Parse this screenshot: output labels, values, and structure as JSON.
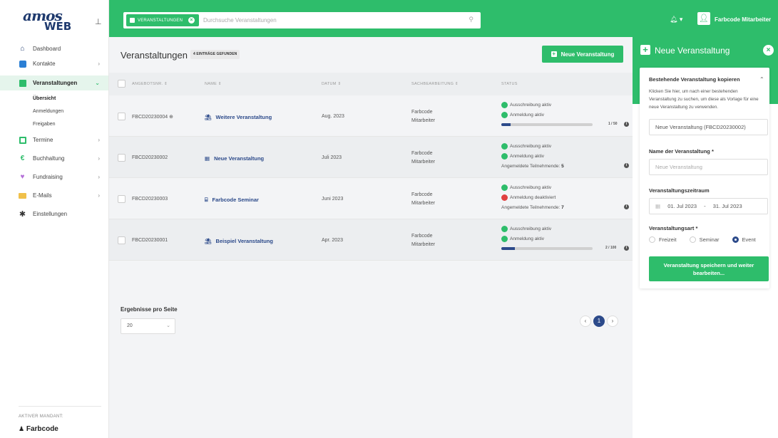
{
  "sidebar": {
    "logo_top": "amos",
    "logo_bottom": "WEB",
    "items": [
      {
        "label": "Dashboard"
      },
      {
        "label": "Kontakte"
      },
      {
        "label": "Veranstaltungen"
      },
      {
        "label": "Termine"
      },
      {
        "label": "Buchhaltung"
      },
      {
        "label": "Fundraising"
      },
      {
        "label": "E-Mails"
      },
      {
        "label": "Einstellungen"
      }
    ],
    "subitems": [
      {
        "label": "Übersicht"
      },
      {
        "label": "Anmeldungen"
      },
      {
        "label": "Freigaben"
      }
    ],
    "mandant_label": "AKTIVER MANDANT:",
    "mandant_name": "Farbcode"
  },
  "topbar": {
    "chip_label": "VERANSTALTUNGEN",
    "search_placeholder": "Durchsuche Veranstaltungen",
    "user_name": "Farbcode Mitarbeiter"
  },
  "main": {
    "title": "Veranstaltungen",
    "count_badge": "4 EINTRÄGE GEFUNDEN",
    "new_button": "Neue Veranstaltung",
    "columns": {
      "number": "ANGEBOTSNR. ⇕",
      "name": "NAME ⇕",
      "date": "DATUM ⇕",
      "staff": "SACHBEARBEITUNG ⇕",
      "status": "STATUS"
    },
    "rows": [
      {
        "number": "FBCD20230004",
        "name": "Weitere Veranstaltung",
        "date": "Aug. 2023",
        "staff_line1": "Farbcode",
        "staff_line2": "Mitarbeiter",
        "status1": "Ausschreibung aktiv",
        "status2": "Anmeldung aktiv",
        "progress_label": "1 / 50",
        "progress_fraction": 0.02
      },
      {
        "number": "FBCD20230002",
        "name": "Neue Veranstaltung",
        "date": "Juli 2023",
        "staff_line1": "Farbcode",
        "staff_line2": "Mitarbeiter",
        "status1": "Ausschreibung aktiv",
        "status2": "Anmeldung aktiv",
        "participants_label": "Angemeldete Teilnehmende:",
        "participants": "5"
      },
      {
        "number": "FBCD20230003",
        "name": "Farbcode Seminar",
        "date": "Juni 2023",
        "staff_line1": "Farbcode",
        "staff_line2": "Mitarbeiter",
        "status1": "Ausschreibung aktiv",
        "status2": "Anmeldung deaktiviert",
        "participants_label": "Angemeldete Teilnehmende:",
        "participants": "7"
      },
      {
        "number": "FBCD20230001",
        "name": "Beispiel Veranstaltung",
        "date": "Apr. 2023",
        "staff_line1": "Farbcode",
        "staff_line2": "Mitarbeiter",
        "status1": "Ausschreibung aktiv",
        "status2": "Anmeldung aktiv",
        "progress_label": "2 / 100",
        "progress_fraction": 0.02
      }
    ],
    "per_page_label": "Ergebnisse pro Seite",
    "per_page_value": "20",
    "current_page": "1"
  },
  "panel": {
    "title": "Neue Veranstaltung",
    "copy_heading": "Bestehende Veranstaltung kopieren",
    "copy_desc": "Klicken Sie hier, um nach einer bestehenden Veranstaltung zu suchen, um diese als Vorlage für eine neue Veranstaltung zu verwenden.",
    "copy_value": "Neue Veranstaltung (FBCD20230002)",
    "name_label": "Name der Veranstaltung *",
    "name_placeholder": "Neue Veranstaltung",
    "period_label": "Veranstaltungszeitraum",
    "period_from": "01. Jul 2023",
    "period_sep": "-",
    "period_to": "31. Jul 2023",
    "type_label": "Veranstaltungsart *",
    "types": [
      "Freizeit",
      "Seminar",
      "Event"
    ],
    "selected_type": "Event",
    "save_button": "Veranstaltung speichern und weiter bearbeiten..."
  },
  "colors": {
    "accent": "#2ebd6b",
    "link": "#2c4a8a",
    "inactive": "#e04040"
  }
}
